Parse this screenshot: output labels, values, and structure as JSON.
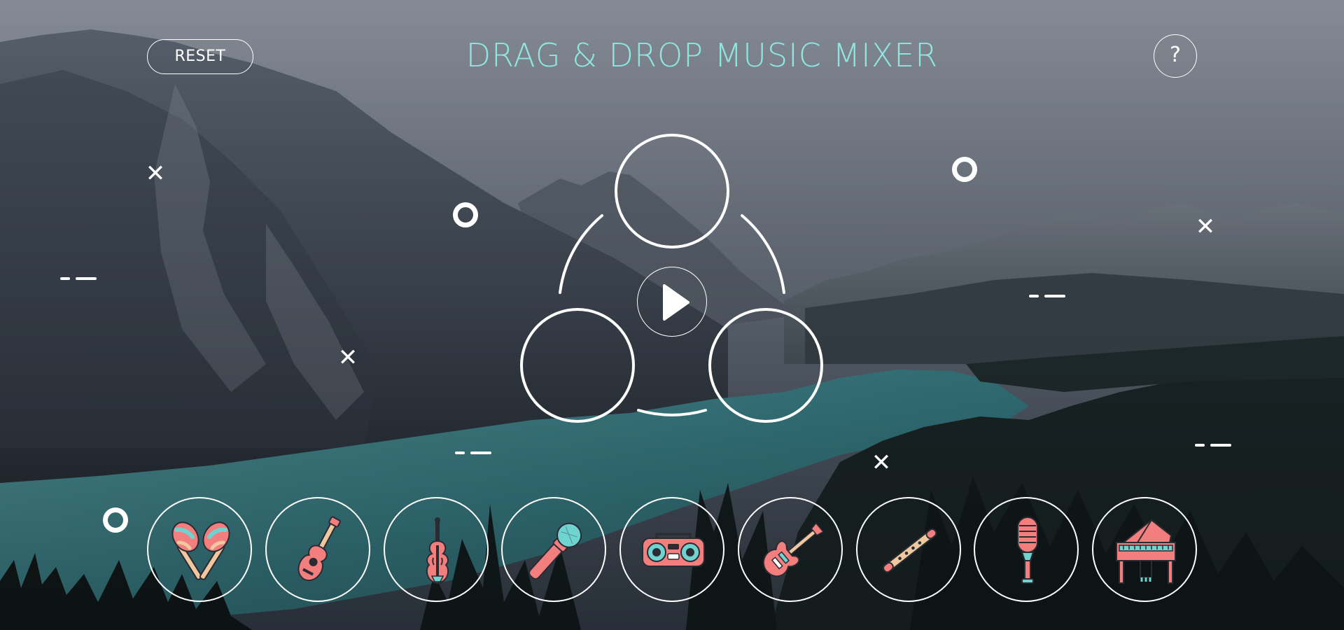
{
  "header": {
    "title": "DRAG & DROP MUSIC MIXER"
  },
  "controls": {
    "reset_label": "RESET",
    "help_label": "?"
  },
  "mixer": {
    "slot_count": 3
  },
  "instruments": [
    {
      "name": "maracas",
      "icon": "maracas-icon"
    },
    {
      "name": "acoustic-guitar",
      "icon": "acoustic-guitar-icon"
    },
    {
      "name": "violin",
      "icon": "violin-icon"
    },
    {
      "name": "microphone",
      "icon": "microphone-icon"
    },
    {
      "name": "boombox",
      "icon": "boombox-icon"
    },
    {
      "name": "electric-guitar",
      "icon": "electric-guitar-icon"
    },
    {
      "name": "flute",
      "icon": "flute-icon"
    },
    {
      "name": "retro-microphone",
      "icon": "retro-microphone-icon"
    },
    {
      "name": "grand-piano",
      "icon": "grand-piano-icon"
    }
  ],
  "colors": {
    "accent": "#8fe6e0",
    "icon_primary": "#f27e7e",
    "icon_secondary": "#6fd3d0",
    "icon_stroke": "#2b2b33",
    "icon_wood": "#f0c8a0"
  }
}
